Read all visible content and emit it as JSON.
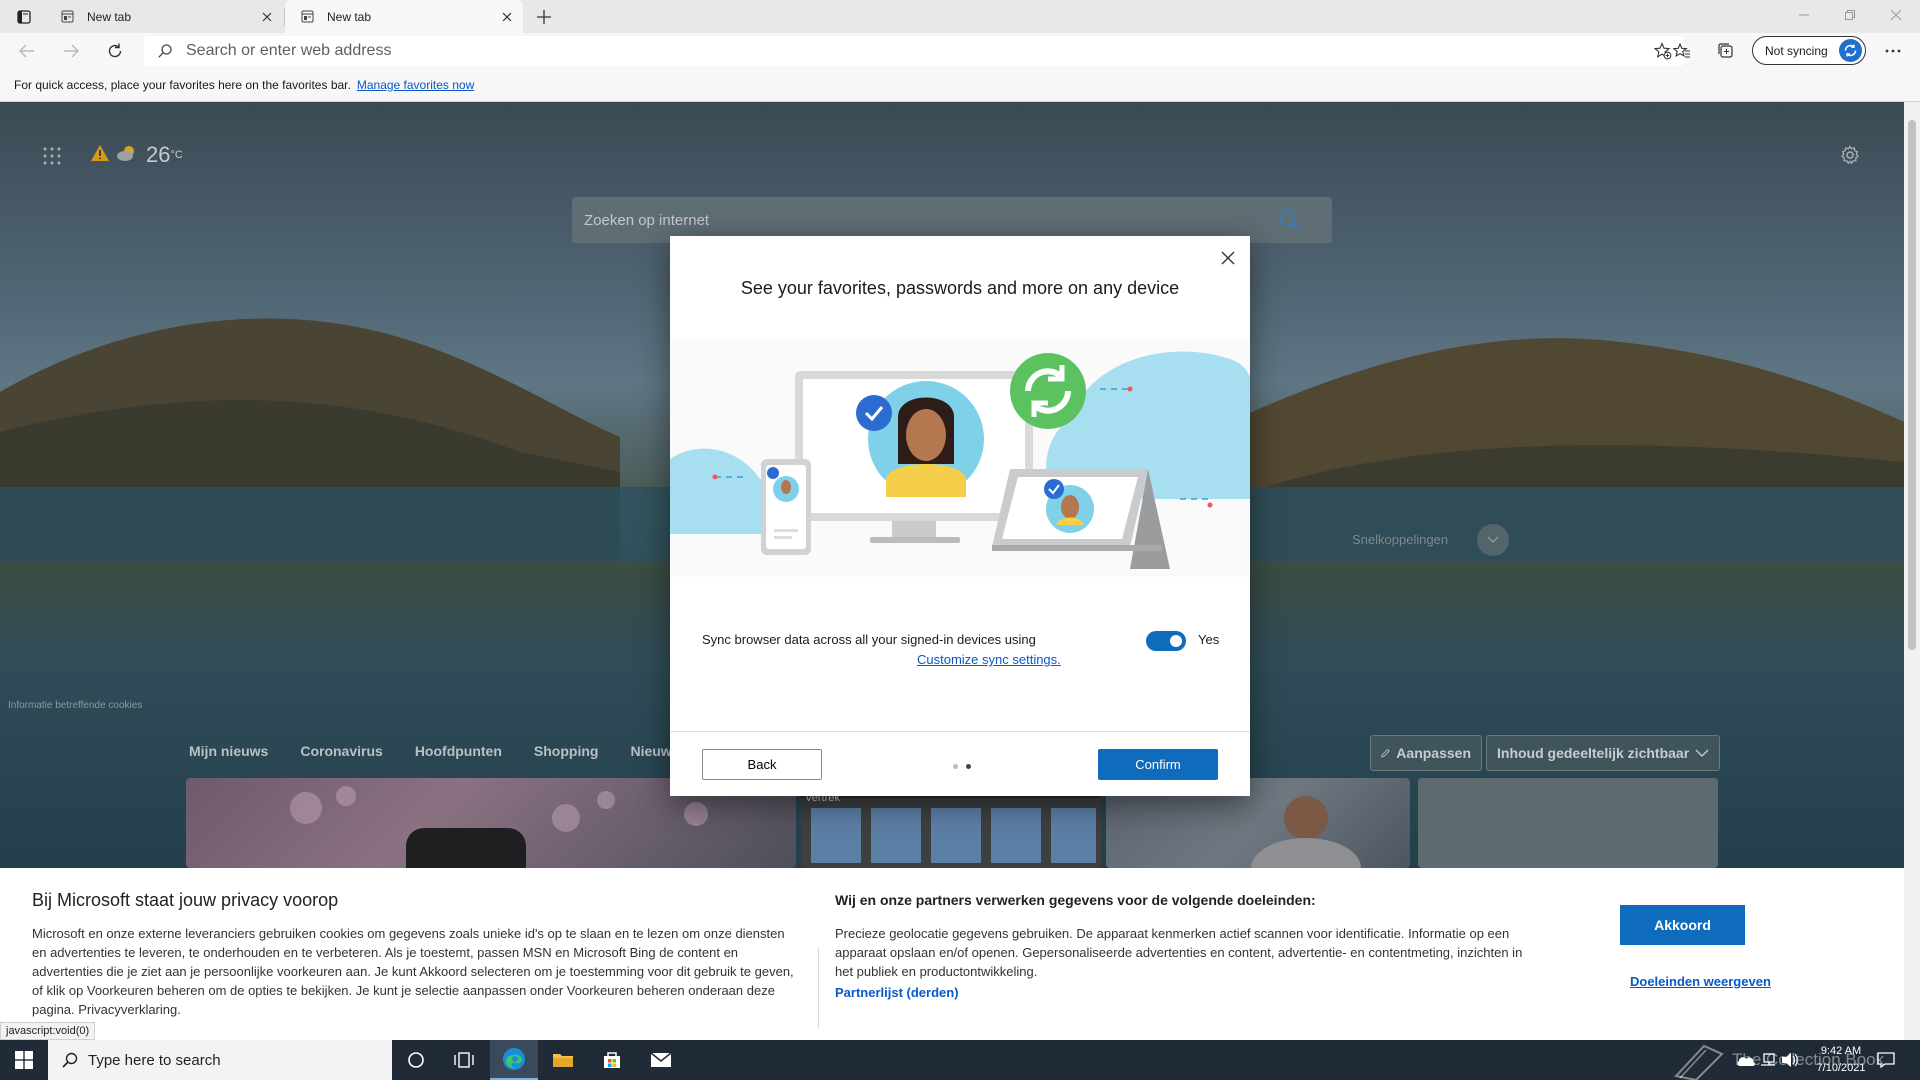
{
  "browser": {
    "tabs": [
      {
        "title": "New tab",
        "active": false
      },
      {
        "title": "New tab",
        "active": true
      }
    ],
    "address_placeholder": "Search or enter web address",
    "sync_label": "Not syncing",
    "favorites_bar": {
      "message": "For quick access, place your favorites here on the favorites bar.",
      "link": "Manage favorites now"
    }
  },
  "newtab": {
    "weather_temp": "26",
    "weather_unit": "°C",
    "search_placeholder": "Zoeken op internet",
    "quick_links": "Snelkoppelingen",
    "cookie_info": "Informatie betreffende cookies",
    "news_tabs": [
      "Mijn nieuws",
      "Coronavirus",
      "Hoofdpunten",
      "Shopping",
      "Nieuws"
    ],
    "customize": "Aanpassen",
    "content_visibility": "Inhoud gedeeltelijk zichtbaar",
    "card_caption": "Departures\nVertrek"
  },
  "sync_dialog": {
    "title": "See your favorites, passwords and more on any device",
    "sync_text": "Sync browser data across all your signed-in devices using",
    "sync_link": "Customize sync settings.",
    "toggle_label": "Yes",
    "toggle_on": true,
    "back": "Back",
    "confirm": "Confirm",
    "page_current": 2,
    "page_total": 2
  },
  "cookie_banner": {
    "title": "Bij Microsoft staat jouw privacy voorop",
    "body": "Microsoft en onze externe leveranciers gebruiken cookies om gegevens zoals unieke id's op te slaan en te lezen om onze diensten en advertenties te leveren, te onderhouden en te verbeteren. Als je toestemt, passen MSN en Microsoft Bing de content en advertenties die je ziet aan je persoonlijke voorkeuren aan. Je kunt Akkoord selecteren om je toestemming voor dit gebruik te geven, of klik op Voorkeuren beheren om de opties te bekijken. Je kunt je selectie aanpassen onder Voorkeuren beheren onderaan deze pagina. Privacyverklaring.",
    "partners_title": "Wij en onze partners verwerken gegevens voor de volgende doeleinden:",
    "partners_body": "Precieze geolocatie gegevens gebruiken. De apparaat kenmerken actief scannen voor identificatie. Informatie op een apparaat opslaan en/of openen. Gepersonaliseerde advertenties en content, advertentie- en contentmeting, inzichten in het publiek en productontwikkeling.",
    "partner_list": "Partnerlijst (derden)",
    "accept": "Akkoord",
    "show_purposes": "Doeleinden weergeven"
  },
  "status_bar": "javascript:void(0)",
  "taskbar": {
    "search_placeholder": "Type here to search",
    "time": "9:42 AM",
    "date": "7/10/2021",
    "watermark": "The Collection Book"
  },
  "colors": {
    "accent": "#0f6cbd",
    "link": "#0a58ca",
    "taskbar": "#202b37"
  }
}
